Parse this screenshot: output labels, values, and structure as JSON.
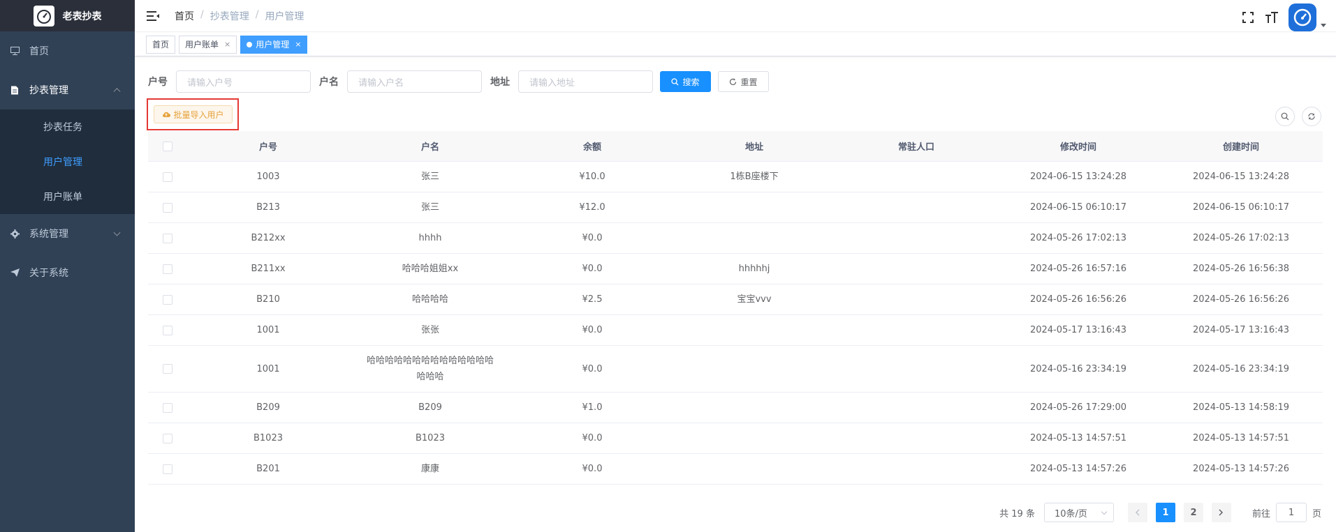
{
  "app": {
    "title": "老表抄表"
  },
  "sidebar": {
    "items": [
      {
        "label": "首页",
        "icon": "monitor-icon"
      },
      {
        "label": "抄表管理",
        "icon": "document-icon",
        "expanded": true,
        "children": [
          {
            "label": "抄表任务"
          },
          {
            "label": "用户管理",
            "active": true
          },
          {
            "label": "用户账单"
          }
        ]
      },
      {
        "label": "系统管理",
        "icon": "gear-icon"
      },
      {
        "label": "关于系统",
        "icon": "send-icon"
      }
    ],
    "bg_color": "#304156",
    "active_color": "#409eff"
  },
  "breadcrumb": [
    "首页",
    "抄表管理",
    "用户管理"
  ],
  "tags": [
    {
      "label": "首页"
    },
    {
      "label": "用户账单"
    },
    {
      "label": "用户管理",
      "active": true
    }
  ],
  "search": {
    "fields": [
      {
        "label": "户号",
        "placeholder": "请输入户号"
      },
      {
        "label": "户名",
        "placeholder": "请输入户名"
      },
      {
        "label": "地址",
        "placeholder": "请输入地址"
      }
    ],
    "search_label": "搜索",
    "reset_label": "重置"
  },
  "toolbar": {
    "import_label": "批量导入用户"
  },
  "table": {
    "headers": [
      "户号",
      "户名",
      "余额",
      "地址",
      "常驻人口",
      "修改时间",
      "创建时间"
    ],
    "rows": [
      [
        "1003",
        "张三",
        "¥10.0",
        "1栋B座楼下",
        "",
        "2024-06-15 13:24:28",
        "2024-06-15 13:24:28"
      ],
      [
        "B213",
        "张三",
        "¥12.0",
        "",
        "",
        "2024-06-15 06:10:17",
        "2024-06-15 06:10:17"
      ],
      [
        "B212xx",
        "hhhh",
        "¥0.0",
        "",
        "",
        "2024-05-26 17:02:13",
        "2024-05-26 17:02:13"
      ],
      [
        "B211xx",
        "哈哈哈姐姐xx",
        "¥0.0",
        "hhhhhj",
        "",
        "2024-05-26 16:57:16",
        "2024-05-26 16:56:38"
      ],
      [
        "B210",
        "哈哈哈哈",
        "¥2.5",
        "宝宝vvv",
        "",
        "2024-05-26 16:56:26",
        "2024-05-26 16:56:26"
      ],
      [
        "1001",
        "张张",
        "¥0.0",
        "",
        "",
        "2024-05-17 13:16:43",
        "2024-05-17 13:16:43"
      ],
      [
        "1001",
        "哈哈哈哈哈哈哈哈哈哈哈哈哈哈哈哈哈",
        "¥0.0",
        "",
        "",
        "2024-05-16 23:34:19",
        "2024-05-16 23:34:19"
      ],
      [
        "B209",
        "B209",
        "¥1.0",
        "",
        "",
        "2024-05-26 17:29:00",
        "2024-05-13 14:58:19"
      ],
      [
        "B1023",
        "B1023",
        "¥0.0",
        "",
        "",
        "2024-05-13 14:57:51",
        "2024-05-13 14:57:51"
      ],
      [
        "B201",
        "康康",
        "¥0.0",
        "",
        "",
        "2024-05-13 14:57:26",
        "2024-05-13 14:57:26"
      ]
    ]
  },
  "pagination": {
    "total_text": "共 19 条",
    "page_size": "10条/页",
    "pages": [
      "1",
      "2"
    ],
    "current": "1",
    "jump_label": "前往",
    "jump_value": "1",
    "jump_suffix": "页"
  }
}
